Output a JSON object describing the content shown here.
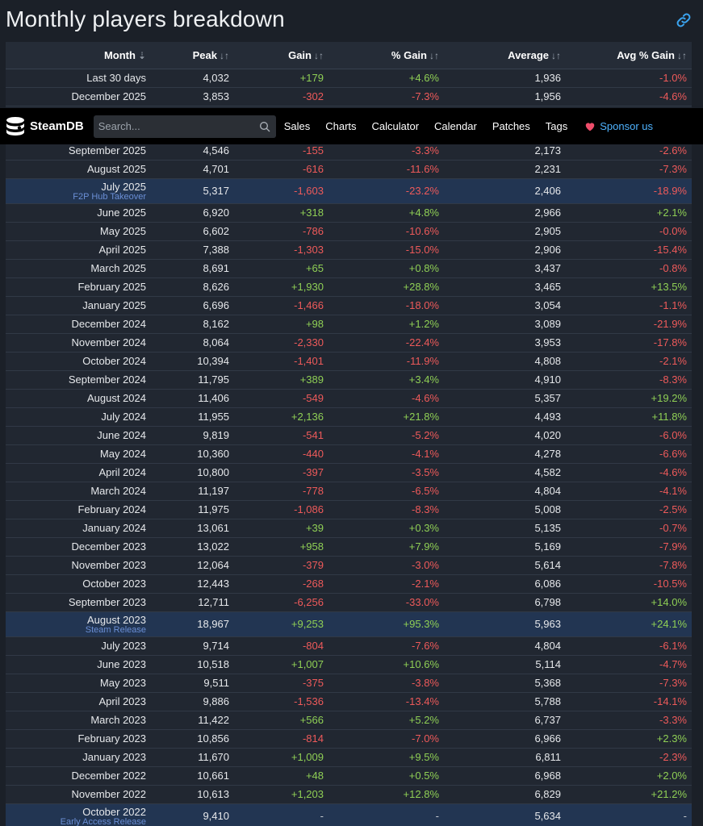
{
  "page": {
    "title": "Monthly players breakdown"
  },
  "table": {
    "headers": {
      "month": "Month",
      "peak": "Peak",
      "gain": "Gain",
      "pct_gain": "% Gain",
      "average": "Average",
      "avg_pct_gain": "Avg % Gain"
    },
    "sort_icons": {
      "month": "⇣",
      "peak": "↓↑",
      "gain": "↓↑",
      "pct_gain": "↓↑",
      "average": "↓↑",
      "avg_pct_gain": "↓↑"
    },
    "rows": [
      {
        "month": "Last 30 days",
        "peak": "4,032",
        "gain": "+179",
        "pct": "+4.6%",
        "avg": "1,936",
        "avgpct": "-1.0%"
      },
      {
        "month": "December 2025",
        "peak": "3,853",
        "gain": "-302",
        "pct": "-7.3%",
        "avg": "1,956",
        "avgpct": "-4.6%"
      },
      {
        "month": "September 2025",
        "peak": "4,546",
        "gain": "-155",
        "pct": "-3.3%",
        "avg": "2,173",
        "avgpct": "-2.6%"
      },
      {
        "month": "August 2025",
        "peak": "4,701",
        "gain": "-616",
        "pct": "-11.6%",
        "avg": "2,231",
        "avgpct": "-7.3%"
      },
      {
        "month": "July 2025",
        "note": "F2P Hub Takeover",
        "peak": "5,317",
        "gain": "-1,603",
        "pct": "-23.2%",
        "avg": "2,406",
        "avgpct": "-18.9%"
      },
      {
        "month": "June 2025",
        "peak": "6,920",
        "gain": "+318",
        "pct": "+4.8%",
        "avg": "2,966",
        "avgpct": "+2.1%"
      },
      {
        "month": "May 2025",
        "peak": "6,602",
        "gain": "-786",
        "pct": "-10.6%",
        "avg": "2,905",
        "avgpct": "-0.0%"
      },
      {
        "month": "April 2025",
        "peak": "7,388",
        "gain": "-1,303",
        "pct": "-15.0%",
        "avg": "2,906",
        "avgpct": "-15.4%"
      },
      {
        "month": "March 2025",
        "peak": "8,691",
        "gain": "+65",
        "pct": "+0.8%",
        "avg": "3,437",
        "avgpct": "-0.8%"
      },
      {
        "month": "February 2025",
        "peak": "8,626",
        "gain": "+1,930",
        "pct": "+28.8%",
        "avg": "3,465",
        "avgpct": "+13.5%"
      },
      {
        "month": "January 2025",
        "peak": "6,696",
        "gain": "-1,466",
        "pct": "-18.0%",
        "avg": "3,054",
        "avgpct": "-1.1%"
      },
      {
        "month": "December 2024",
        "peak": "8,162",
        "gain": "+98",
        "pct": "+1.2%",
        "avg": "3,089",
        "avgpct": "-21.9%"
      },
      {
        "month": "November 2024",
        "peak": "8,064",
        "gain": "-2,330",
        "pct": "-22.4%",
        "avg": "3,953",
        "avgpct": "-17.8%"
      },
      {
        "month": "October 2024",
        "peak": "10,394",
        "gain": "-1,401",
        "pct": "-11.9%",
        "avg": "4,808",
        "avgpct": "-2.1%"
      },
      {
        "month": "September 2024",
        "peak": "11,795",
        "gain": "+389",
        "pct": "+3.4%",
        "avg": "4,910",
        "avgpct": "-8.3%"
      },
      {
        "month": "August 2024",
        "peak": "11,406",
        "gain": "-549",
        "pct": "-4.6%",
        "avg": "5,357",
        "avgpct": "+19.2%"
      },
      {
        "month": "July 2024",
        "peak": "11,955",
        "gain": "+2,136",
        "pct": "+21.8%",
        "avg": "4,493",
        "avgpct": "+11.8%"
      },
      {
        "month": "June 2024",
        "peak": "9,819",
        "gain": "-541",
        "pct": "-5.2%",
        "avg": "4,020",
        "avgpct": "-6.0%"
      },
      {
        "month": "May 2024",
        "peak": "10,360",
        "gain": "-440",
        "pct": "-4.1%",
        "avg": "4,278",
        "avgpct": "-6.6%"
      },
      {
        "month": "April 2024",
        "peak": "10,800",
        "gain": "-397",
        "pct": "-3.5%",
        "avg": "4,582",
        "avgpct": "-4.6%"
      },
      {
        "month": "March 2024",
        "peak": "11,197",
        "gain": "-778",
        "pct": "-6.5%",
        "avg": "4,804",
        "avgpct": "-4.1%"
      },
      {
        "month": "February 2024",
        "peak": "11,975",
        "gain": "-1,086",
        "pct": "-8.3%",
        "avg": "5,008",
        "avgpct": "-2.5%"
      },
      {
        "month": "January 2024",
        "peak": "13,061",
        "gain": "+39",
        "pct": "+0.3%",
        "avg": "5,135",
        "avgpct": "-0.7%"
      },
      {
        "month": "December 2023",
        "peak": "13,022",
        "gain": "+958",
        "pct": "+7.9%",
        "avg": "5,169",
        "avgpct": "-7.9%"
      },
      {
        "month": "November 2023",
        "peak": "12,064",
        "gain": "-379",
        "pct": "-3.0%",
        "avg": "5,614",
        "avgpct": "-7.8%"
      },
      {
        "month": "October 2023",
        "peak": "12,443",
        "gain": "-268",
        "pct": "-2.1%",
        "avg": "6,086",
        "avgpct": "-10.5%"
      },
      {
        "month": "September 2023",
        "peak": "12,711",
        "gain": "-6,256",
        "pct": "-33.0%",
        "avg": "6,798",
        "avgpct": "+14.0%"
      },
      {
        "month": "August 2023",
        "note": "Steam Release",
        "peak": "18,967",
        "gain": "+9,253",
        "pct": "+95.3%",
        "avg": "5,963",
        "avgpct": "+24.1%"
      },
      {
        "month": "July 2023",
        "peak": "9,714",
        "gain": "-804",
        "pct": "-7.6%",
        "avg": "4,804",
        "avgpct": "-6.1%"
      },
      {
        "month": "June 2023",
        "peak": "10,518",
        "gain": "+1,007",
        "pct": "+10.6%",
        "avg": "5,114",
        "avgpct": "-4.7%"
      },
      {
        "month": "May 2023",
        "peak": "9,511",
        "gain": "-375",
        "pct": "-3.8%",
        "avg": "5,368",
        "avgpct": "-7.3%"
      },
      {
        "month": "April 2023",
        "peak": "9,886",
        "gain": "-1,536",
        "pct": "-13.4%",
        "avg": "5,788",
        "avgpct": "-14.1%"
      },
      {
        "month": "March 2023",
        "peak": "11,422",
        "gain": "+566",
        "pct": "+5.2%",
        "avg": "6,737",
        "avgpct": "-3.3%"
      },
      {
        "month": "February 2023",
        "peak": "10,856",
        "gain": "-814",
        "pct": "-7.0%",
        "avg": "6,966",
        "avgpct": "+2.3%"
      },
      {
        "month": "January 2023",
        "peak": "11,670",
        "gain": "+1,009",
        "pct": "+9.5%",
        "avg": "6,811",
        "avgpct": "-2.3%"
      },
      {
        "month": "December 2022",
        "peak": "10,661",
        "gain": "+48",
        "pct": "+0.5%",
        "avg": "6,968",
        "avgpct": "+2.0%"
      },
      {
        "month": "November 2022",
        "peak": "10,613",
        "gain": "+1,203",
        "pct": "+12.8%",
        "avg": "6,829",
        "avgpct": "+21.2%"
      },
      {
        "month": "October 2022",
        "note": "Early Access Release",
        "peak": "9,410",
        "gain": "-",
        "pct": "-",
        "avg": "5,634",
        "avgpct": "-"
      }
    ]
  },
  "navbar": {
    "logo_text": "SteamDB",
    "search_placeholder": "Search...",
    "items": [
      "Sales",
      "Charts",
      "Calculator",
      "Calendar",
      "Patches",
      "Tags"
    ],
    "sponsor_label": "Sponsor us"
  },
  "colors": {
    "positive": "#8fcf55",
    "negative": "#ee5a5a",
    "note": "#6b8fd6",
    "sponsor": "#4fb3ff"
  },
  "icons": {
    "permalink": "link-icon",
    "search": "search-icon",
    "sponsor": "heart-icon",
    "logo": "steamdb-logo-icon"
  }
}
